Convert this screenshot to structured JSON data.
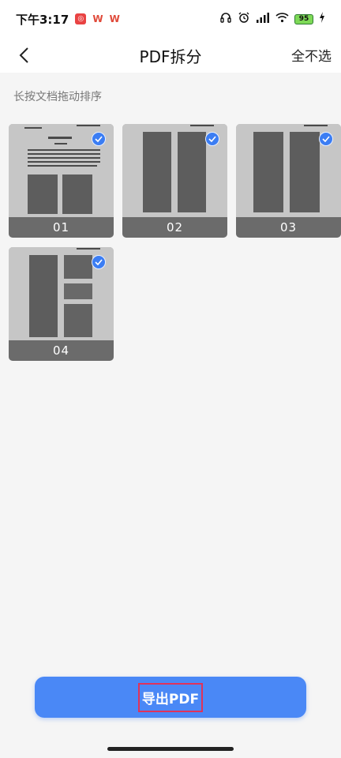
{
  "status_bar": {
    "time": "下午3:17",
    "battery": "95"
  },
  "header": {
    "title": "PDF拆分",
    "right_action": "全不选"
  },
  "hint": "长按文档拖动排序",
  "pages": [
    {
      "label": "01",
      "selected": true
    },
    {
      "label": "02",
      "selected": true
    },
    {
      "label": "03",
      "selected": true
    },
    {
      "label": "04",
      "selected": true
    }
  ],
  "export_button": {
    "label": "导出PDF"
  },
  "colors": {
    "accent": "#4a88f6",
    "check": "#3b7df3",
    "highlight_box": "#e0325a"
  }
}
